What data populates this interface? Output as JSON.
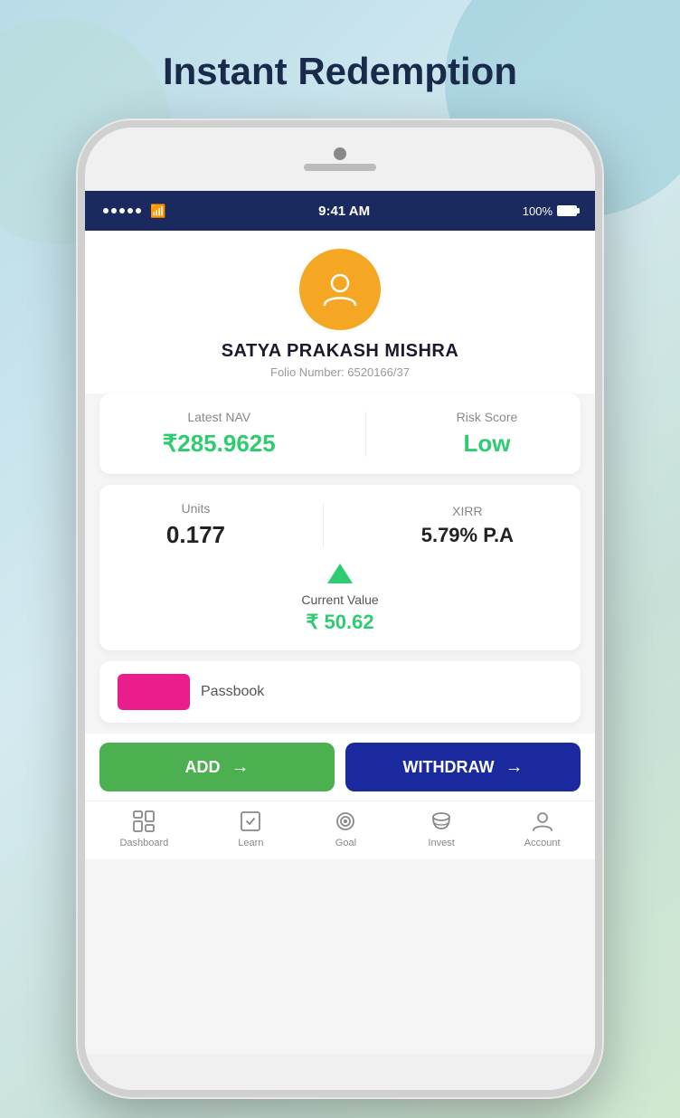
{
  "page": {
    "title": "Instant Redemption"
  },
  "statusBar": {
    "time": "9:41 AM",
    "battery": "100%"
  },
  "profile": {
    "name": "SATYA PRAKASH MISHRA",
    "folioLabel": "Folio Number:",
    "folioNumber": "6520166/37"
  },
  "statsCard1": {
    "navLabel": "Latest NAV",
    "navValue": "₹285.9625",
    "riskLabel": "Risk Score",
    "riskValue": "Low"
  },
  "statsCard2": {
    "unitsLabel": "Units",
    "unitsValue": "0.177",
    "xirrLabel": "XIRR",
    "xirrValue": "5.79% P.A",
    "currentValueLabel": "Current Value",
    "currentValueAmount": "₹ 50.62"
  },
  "passbook": {
    "label": "Passbook"
  },
  "buttons": {
    "add": "ADD",
    "withdraw": "WITHDRAW"
  },
  "bottomNav": {
    "items": [
      {
        "label": "Dashboard",
        "icon": "dashboard"
      },
      {
        "label": "Learn",
        "icon": "learn"
      },
      {
        "label": "Goal",
        "icon": "goal"
      },
      {
        "label": "Invest",
        "icon": "invest"
      },
      {
        "label": "Account",
        "icon": "account"
      }
    ]
  }
}
